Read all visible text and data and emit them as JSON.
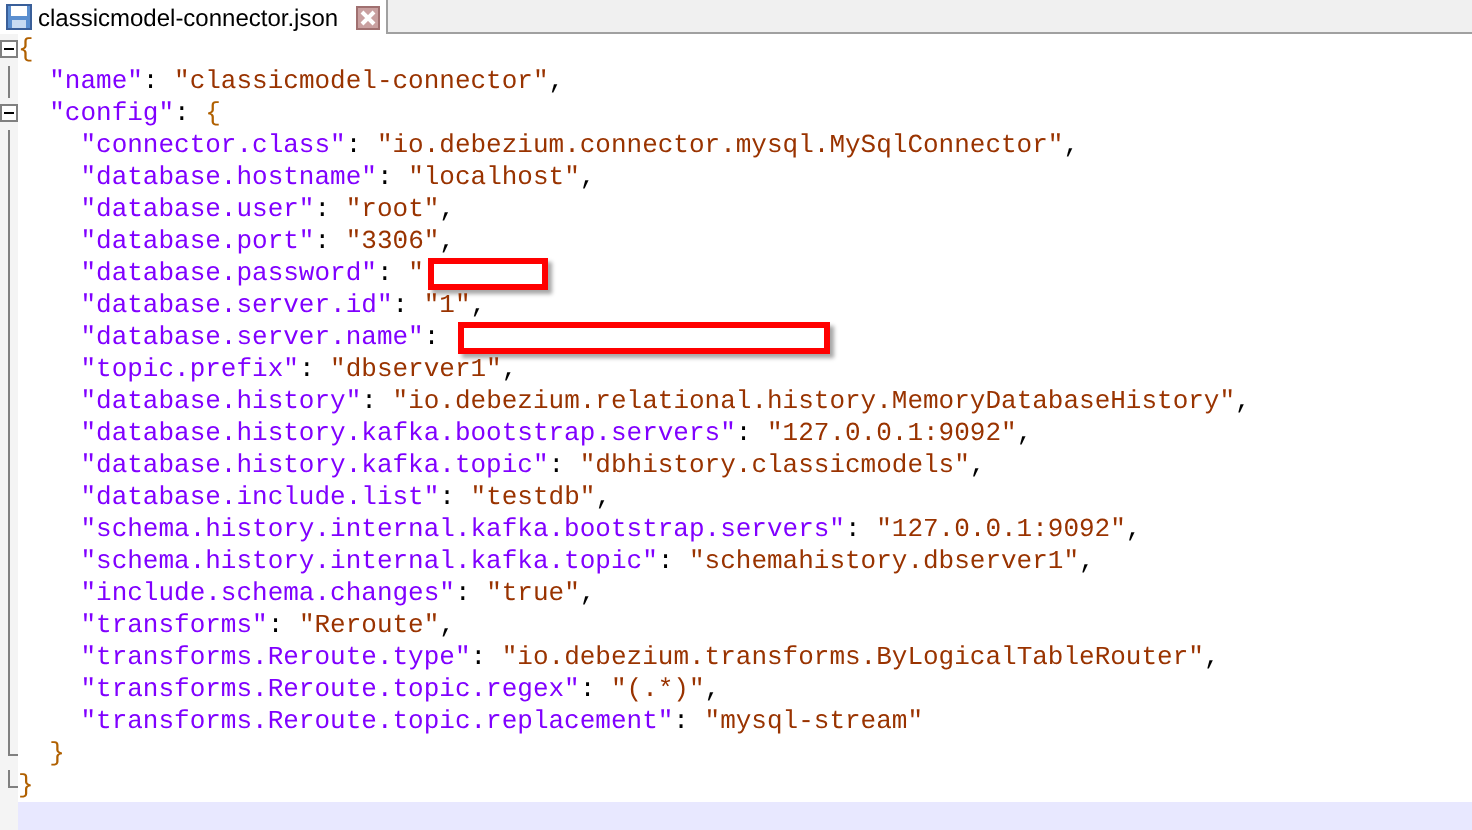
{
  "tabs": [
    {
      "label": "classicmodel-connector.json",
      "selected": true
    }
  ],
  "editor": {
    "lines": [
      {
        "kind": "fold",
        "text": "{",
        "current": false
      },
      {
        "kind": "code",
        "text": "  \"name\": \"classicmodel-connector\",",
        "current": false
      },
      {
        "kind": "fold",
        "text": "  \"config\": {",
        "current": false
      },
      {
        "kind": "code",
        "text": "    \"connector.class\": \"io.debezium.connector.mysql.MySqlConnector\",",
        "current": false
      },
      {
        "kind": "code",
        "text": "    \"database.hostname\": \"localhost\",",
        "current": false
      },
      {
        "kind": "code",
        "text": "    \"database.user\": \"root\",",
        "current": false
      },
      {
        "kind": "code",
        "text": "    \"database.port\": \"3306\",",
        "current": false
      },
      {
        "kind": "redacted",
        "text": "    \"database.password\": \"",
        "current": false
      },
      {
        "kind": "code",
        "text": "    \"database.server.id\": \"1\",",
        "current": false
      },
      {
        "kind": "redactedwide",
        "text": "    \"database.server.name\": ",
        "current": false
      },
      {
        "kind": "code",
        "text": "    \"topic.prefix\": \"dbserver1\",",
        "current": false
      },
      {
        "kind": "code",
        "text": "    \"database.history\": \"io.debezium.relational.history.MemoryDatabaseHistory\",",
        "current": false
      },
      {
        "kind": "code",
        "text": "    \"database.history.kafka.bootstrap.servers\": \"127.0.0.1:9092\",",
        "current": false
      },
      {
        "kind": "code",
        "text": "    \"database.history.kafka.topic\": \"dbhistory.classicmodels\",",
        "current": false
      },
      {
        "kind": "code",
        "text": "    \"database.include.list\": \"testdb\",",
        "current": false
      },
      {
        "kind": "code",
        "text": "    \"schema.history.internal.kafka.bootstrap.servers\": \"127.0.0.1:9092\",",
        "current": false
      },
      {
        "kind": "code",
        "text": "    \"schema.history.internal.kafka.topic\": \"schemahistory.dbserver1\",",
        "current": false
      },
      {
        "kind": "code",
        "text": "    \"include.schema.changes\": \"true\",",
        "current": false
      },
      {
        "kind": "code",
        "text": "    \"transforms\": \"Reroute\",",
        "current": false
      },
      {
        "kind": "code",
        "text": "    \"transforms.Reroute.type\": \"io.debezium.transforms.ByLogicalTableRouter\",",
        "current": false
      },
      {
        "kind": "code",
        "text": "    \"transforms.Reroute.topic.regex\": \"(.*)\",",
        "current": false
      },
      {
        "kind": "code",
        "text": "    \"transforms.Reroute.topic.replacement\": \"mysql-stream\"",
        "current": false
      },
      {
        "kind": "foldend",
        "text": "  }",
        "current": false
      },
      {
        "kind": "foldend",
        "text": "}",
        "current": false
      },
      {
        "kind": "code",
        "current": true
      }
    ]
  }
}
